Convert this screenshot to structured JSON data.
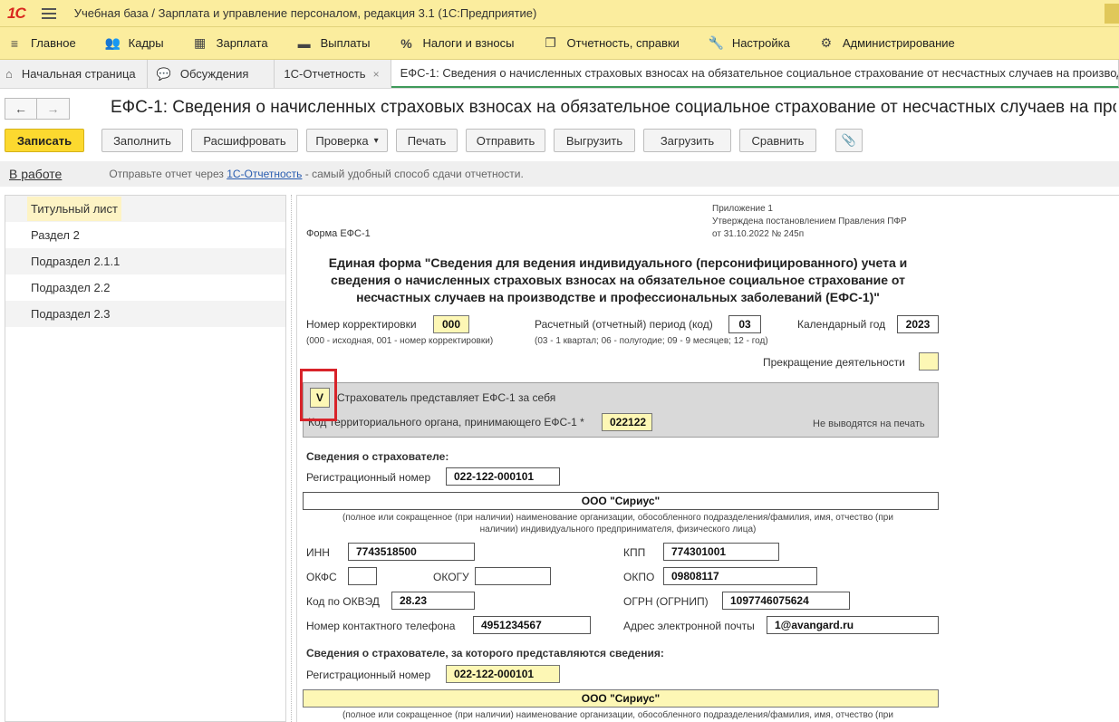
{
  "app": {
    "logo": "1С",
    "title": "Учебная база / Зарплата и управление персоналом, редакция 3.1  (1С:Предприятие)"
  },
  "menu": [
    {
      "label": "Главное",
      "icon": "≡"
    },
    {
      "label": "Кадры",
      "icon": "👥"
    },
    {
      "label": "Зарплата",
      "icon": "▦"
    },
    {
      "label": "Выплаты",
      "icon": "▬"
    },
    {
      "label": "Налоги и взносы",
      "icon": "%"
    },
    {
      "label": "Отчетность, справки",
      "icon": "❐"
    },
    {
      "label": "Настройка",
      "icon": "🔧"
    },
    {
      "label": "Администрирование",
      "icon": "⚙"
    }
  ],
  "tabs": [
    {
      "label": "Начальная страница",
      "icon": "⌂"
    },
    {
      "label": "Обсуждения",
      "icon": "💬"
    },
    {
      "label": "1С-Отчетность",
      "close": "×"
    },
    {
      "label": "ЕФС-1: Сведения о начисленных страховых взносах на обязательное социальное страхование от несчастных случаев на производстве"
    }
  ],
  "nav": {
    "back": "←",
    "forward": "→"
  },
  "document": {
    "title": "ЕФС-1: Сведения о начисленных страховых взносах на обязательное социальное страхование от несчастных случаев на производстве"
  },
  "toolbar": {
    "save": "Записать",
    "fill": "Заполнить",
    "decode": "Расшифровать",
    "check": "Проверка",
    "check_arrow": "▾",
    "print": "Печать",
    "send": "Отправить",
    "export": "Выгрузить",
    "import": "Загрузить",
    "compare": "Сравнить",
    "attach": "📎"
  },
  "info": {
    "status": "В работе",
    "hint_before": "Отправьте отчет через ",
    "hint_link": "1С-Отчетность",
    "hint_after": " - самый удобный способ сдачи отчетности."
  },
  "sidebar": [
    {
      "label": "Титульный лист"
    },
    {
      "label": "Раздел 2"
    },
    {
      "label": "Подраздел 2.1.1"
    },
    {
      "label": "Подраздел 2.2"
    },
    {
      "label": "Подраздел 2.3"
    }
  ],
  "form": {
    "appendix_1": "Приложение 1",
    "appendix_2": "Утверждена постановлением Правления ПФР",
    "appendix_3": "от 31.10.2022 № 245п",
    "form_name": "Форма ЕФС-1",
    "title_1": "Единая форма \"Сведения для ведения индивидуального (персонифицированного) учета и",
    "title_2": "сведения о начисленных страховых взносах на обязательное социальное страхование от",
    "title_3": "несчастных случаев на производстве и профессиональных заболеваний (ЕФС-1)\"",
    "corr_label": "Номер корректировки",
    "corr_value": "000",
    "corr_hint": "(000 - исходная, 001 - номер корректировки)",
    "period_label": "Расчетный (отчетный) период (код)",
    "period_value": "03",
    "period_hint": "(03 - 1 квартал; 06 - полугодие; 09 - 9 месяцев; 12 - год)",
    "year_label": "Календарный год",
    "year_value": "2023",
    "termination_label": "Прекращение деятельности",
    "self_check": "V",
    "self_label": "Страхователь представляет ЕФС-1 за себя",
    "territorial_label": "Код территориального органа, принимающего ЕФС-1 *",
    "territorial_value": "022122",
    "not_printed": "Не выводятся на печать",
    "insurer_header": "Сведения о страхователе:",
    "reg_label": "Регистрационный номер",
    "reg_value": "022-122-000101",
    "org_name": "ООО \"Сириус\"",
    "org_hint_1": "(полное или сокращенное (при наличии) наименование организации, обособленного подразделения/фамилия, имя, отчество (при",
    "org_hint_2": "наличии) индивидуального предпринимателя, физического лица)",
    "inn_label": "ИНН",
    "inn_value": "7743518500",
    "kpp_label": "КПП",
    "kpp_value": "774301001",
    "okfs_label": "ОКФС",
    "okfs_value": "",
    "okogu_label": "ОКОГУ",
    "okogu_value": "",
    "okpo_label": "ОКПО",
    "okpo_value": "09808117",
    "okved_label": "Код по ОКВЭД",
    "okved_value": "28.23",
    "ogrn_label": "ОГРН (ОГРНИП)",
    "ogrn_value": "1097746075624",
    "phone_label": "Номер контактного телефона",
    "phone_value": "4951234567",
    "email_label": "Адрес электронной почты",
    "email_value": "1@avangard.ru",
    "insurer2_header": "Сведения о страхователе, за которого представляются сведения:",
    "reg2_label": "Регистрационный номер",
    "reg2_value": "022-122-000101",
    "org2_name": "ООО \"Сириус\"",
    "org2_hint": "(полное или сокращенное (при наличии) наименование организации, обособленного подразделения/фамилия, имя, отчество (при"
  }
}
